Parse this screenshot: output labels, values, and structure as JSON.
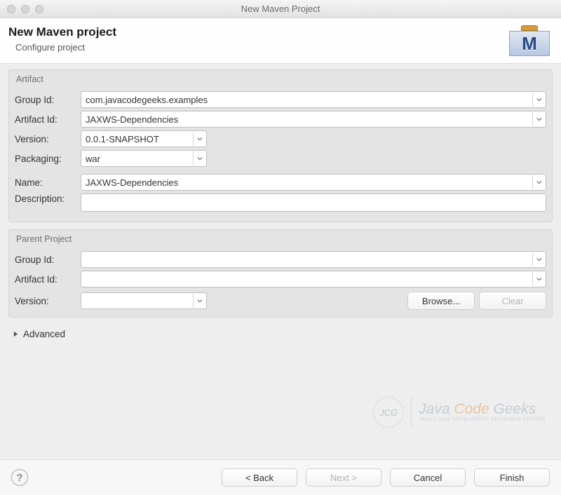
{
  "window": {
    "title": "New Maven Project"
  },
  "header": {
    "title": "New Maven project",
    "subtitle": "Configure project",
    "iconLetter": "M"
  },
  "artifact": {
    "legend": "Artifact",
    "groupIdLabel": "Group Id:",
    "groupIdValue": "com.javacodegeeks.examples",
    "artifactIdLabel": "Artifact Id:",
    "artifactIdValue": "JAXWS-Dependencies",
    "versionLabel": "Version:",
    "versionValue": "0.0.1-SNAPSHOT",
    "packagingLabel": "Packaging:",
    "packagingValue": "war",
    "nameLabel": "Name:",
    "nameValue": "JAXWS-Dependencies",
    "descriptionLabel": "Description:",
    "descriptionValue": ""
  },
  "parent": {
    "legend": "Parent Project",
    "groupIdLabel": "Group Id:",
    "groupIdValue": "",
    "artifactIdLabel": "Artifact Id:",
    "artifactIdValue": "",
    "versionLabel": "Version:",
    "versionValue": "",
    "browseLabel": "Browse...",
    "clearLabel": "Clear"
  },
  "advanced": {
    "label": "Advanced"
  },
  "watermark": {
    "abbrev": "JCG",
    "line1a": "Java ",
    "line1b": "Code ",
    "line1c": "Geeks",
    "line2": "JAVA 2 JAVA DEVELOPERS RESOURCE CENTER"
  },
  "footer": {
    "back": "< Back",
    "next": "Next >",
    "cancel": "Cancel",
    "finish": "Finish"
  }
}
